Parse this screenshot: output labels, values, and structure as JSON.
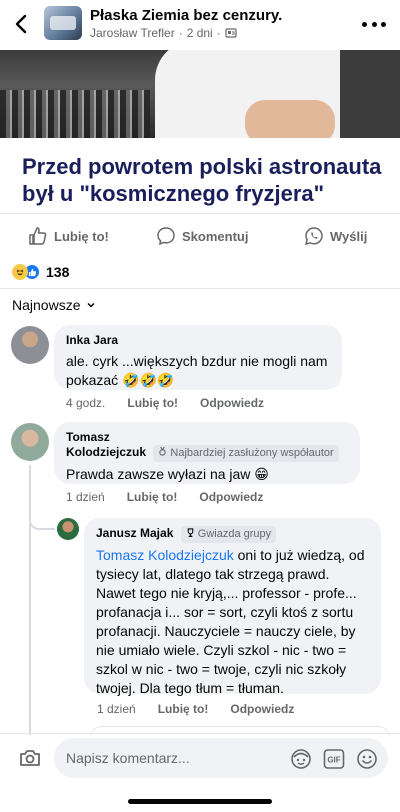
{
  "header": {
    "group_name": "Płaska Ziemia bez cenzury.",
    "author": "Jarosław Trefler",
    "time": "2 dni"
  },
  "article": {
    "headline": "Przed powrotem polski astronauta był u \"kosmicznego fryzjera\""
  },
  "actions": {
    "like": "Lubię to!",
    "comment": "Skomentuj",
    "send": "Wyślij"
  },
  "reactions": {
    "count": "138"
  },
  "sort": {
    "label": "Najnowsze"
  },
  "comments": [
    {
      "name": "Inka Jara",
      "text": "ale. cyrk ...większych bzdur nie mogli nam pokazać 🤣🤣🤣",
      "time": "4 godz.",
      "like": "Lubię to!",
      "reply": "Odpowiedz"
    },
    {
      "name_line1": "Tomasz",
      "name_line2": "Kolodziejczuk",
      "badge": "Najbardziej zasłużony współautor",
      "text": "Prawda zawsze wyłazi na jaw 😁",
      "time": "1 dzień",
      "like": "Lubię to!",
      "reply": "Odpowiedz"
    },
    {
      "name": "Janusz Majak",
      "badge": "Gwiazda grupy",
      "mention": "Tomasz Kolodziejczuk",
      "text": "oni to już wiedzą, od tysiecy lat, dlatego tak strzegą prawd. Nawet tego nie kryją,... professor - profe... profanacja i... sor = sort, czyli ktoś z sortu profanacji. Nauczyciele = nauczy ciele, by nie umiało wiele. Czyli szkol - nic - two = szkol w nic - two = twoje, czyli nic szkoły twojej. Dla tego tłum = tłuman.",
      "time": "1 dzień",
      "like": "Lubię to!",
      "reply": "Odpowiedz"
    }
  ],
  "composer": {
    "placeholder": "Napisz komentarz..."
  }
}
